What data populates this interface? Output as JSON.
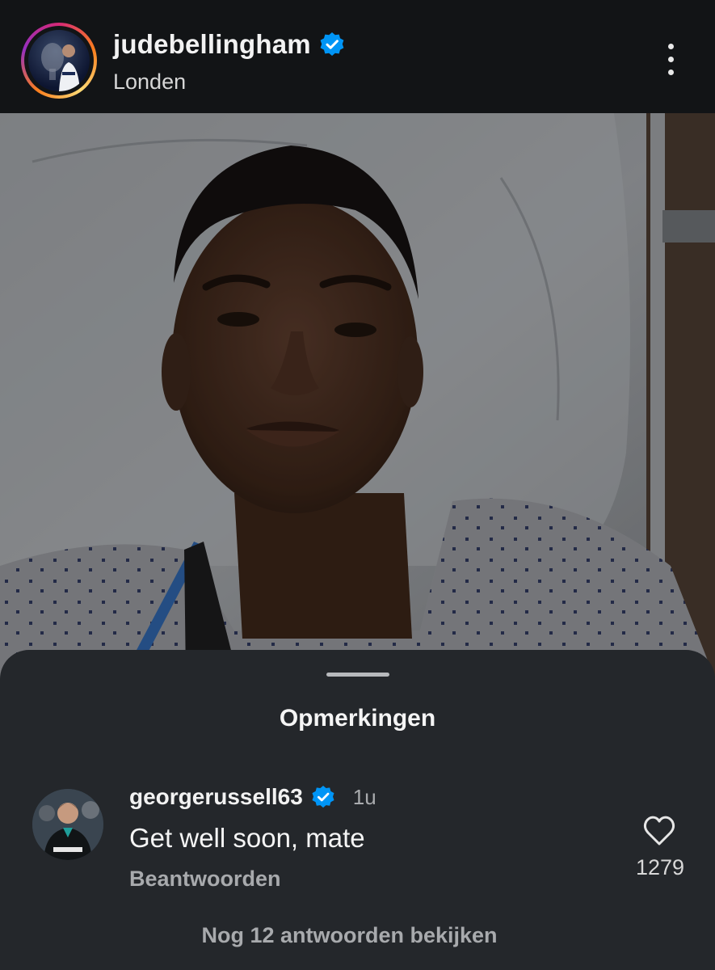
{
  "post": {
    "username": "judebellingham",
    "location": "Londen",
    "verified": true,
    "image_alt": "Selfie in hospital bed"
  },
  "comments": {
    "title": "Opmerkingen",
    "items": [
      {
        "username": "georgerussell63",
        "verified": true,
        "time": "1u",
        "text": "Get well soon, mate",
        "reply_label": "Beantwoorden",
        "likes": "1279"
      }
    ],
    "view_replies_label": "Nog 12 antwoorden bekijken"
  },
  "colors": {
    "verified_blue": "#0095f6",
    "sheet_bg": "#24272b",
    "header_bg": "#121416"
  },
  "icons": [
    "more-options-icon",
    "verified-badge-icon",
    "heart-icon"
  ]
}
